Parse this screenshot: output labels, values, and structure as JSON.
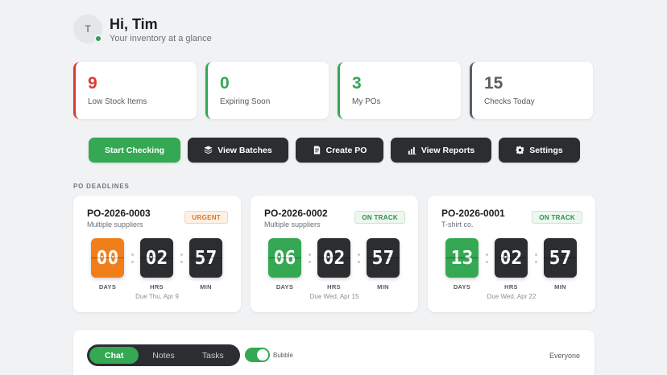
{
  "header": {
    "avatar_initial": "T",
    "title": "Hi, Tim",
    "subtitle": "Your inventory at a glance",
    "online_color": "#2f9e4f"
  },
  "stats": [
    {
      "value": "9",
      "label": "Low Stock Items",
      "color": "#dc3a31"
    },
    {
      "value": "0",
      "label": "Expiring Soon",
      "color": "#34a853"
    },
    {
      "value": "3",
      "label": "My POs",
      "color": "#34a853"
    },
    {
      "value": "15",
      "label": "Checks Today",
      "color": "#595f66"
    }
  ],
  "actions": [
    {
      "label": "Start Checking",
      "icon": "none",
      "style": "green"
    },
    {
      "label": "View Batches",
      "icon": "layers-icon",
      "style": "dark"
    },
    {
      "label": "Create PO",
      "icon": "document-icon",
      "style": "dark"
    },
    {
      "label": "View Reports",
      "icon": "bar-chart-icon",
      "style": "dark"
    },
    {
      "label": "Settings",
      "icon": "gear-icon",
      "style": "dark"
    }
  ],
  "po_section": {
    "label": "PO DEADLINES",
    "cards": [
      {
        "id": "PO-2026-0003",
        "supplier": "Multiple suppliers",
        "status": "URGENT",
        "status_type": "urgent",
        "days": "00",
        "hrs": "02",
        "min": "57",
        "days_color": "orange",
        "due": "Due Thu, Apr 9"
      },
      {
        "id": "PO-2026-0002",
        "supplier": "Multiple suppliers",
        "status": "ON TRACK",
        "status_type": "ontrack",
        "days": "06",
        "hrs": "02",
        "min": "57",
        "days_color": "green",
        "due": "Due Wed, Apr 15"
      },
      {
        "id": "PO-2026-0001",
        "supplier": "T-shirt co.",
        "status": "ON TRACK",
        "status_type": "ontrack",
        "days": "13",
        "hrs": "02",
        "min": "57",
        "days_color": "green",
        "due": "Due Wed, Apr 22"
      }
    ],
    "units": {
      "days": "DAYS",
      "hrs": "HRS",
      "min": "MIN"
    }
  },
  "chat": {
    "tabs": [
      "Chat",
      "Notes",
      "Tasks"
    ],
    "active_tab": "Chat",
    "toggle_label": "Bubble",
    "toggle_on": true,
    "audience": "Everyone"
  }
}
